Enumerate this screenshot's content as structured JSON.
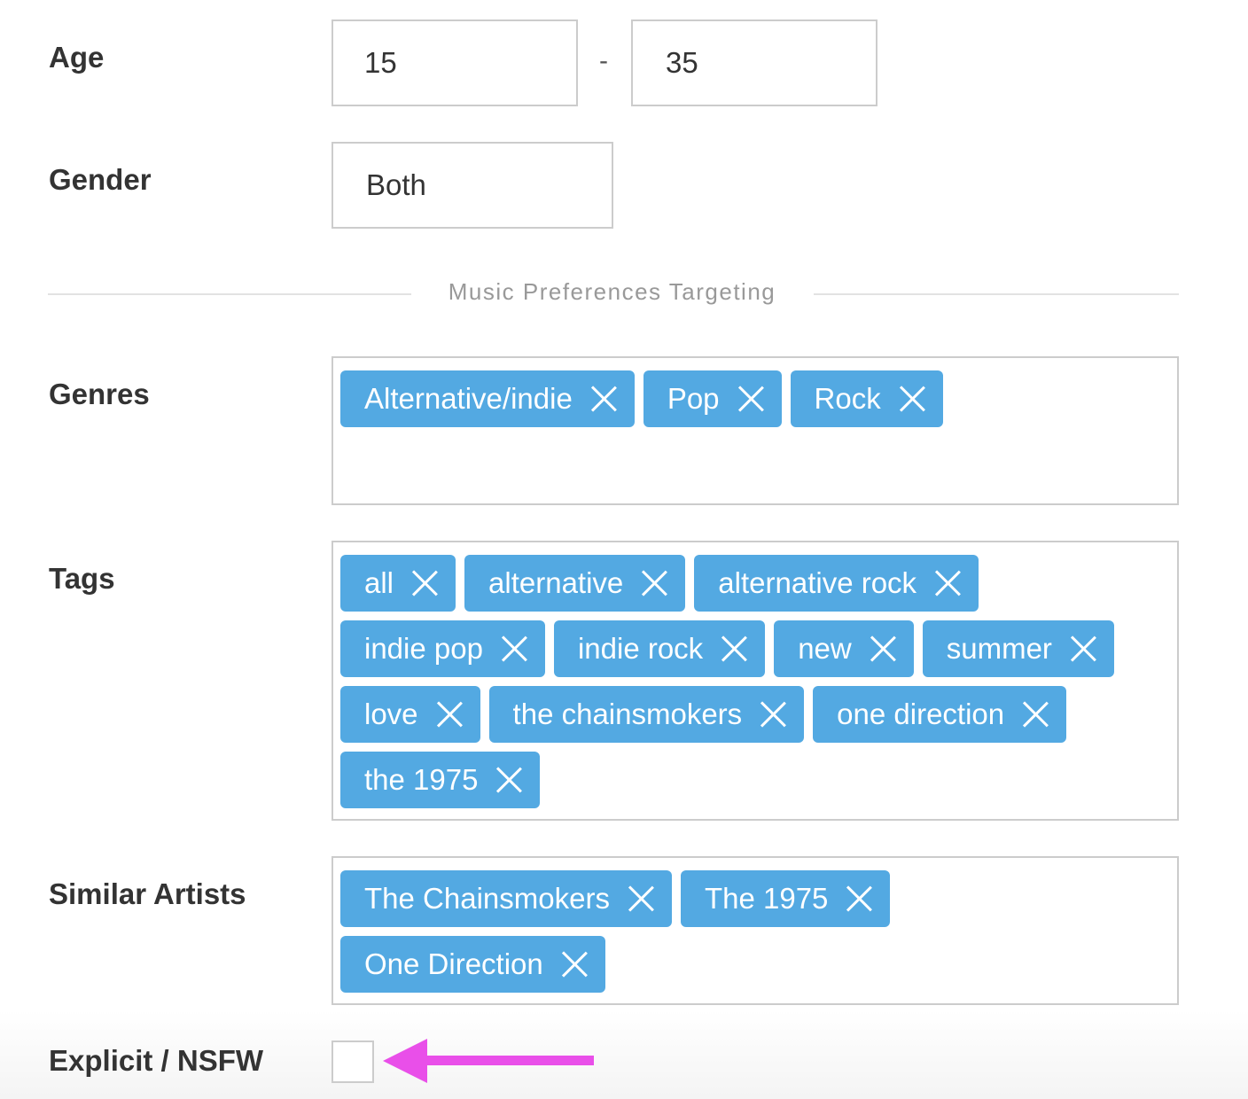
{
  "age": {
    "label": "Age",
    "min_value": "15",
    "separator": "-",
    "max_value": "35"
  },
  "gender": {
    "label": "Gender",
    "value": "Both"
  },
  "section_divider": "Music Preferences Targeting",
  "genres": {
    "label": "Genres",
    "tags": [
      "Alternative/indie",
      "Pop",
      "Rock"
    ]
  },
  "tags": {
    "label": "Tags",
    "tags": [
      "all",
      "alternative",
      "alternative rock",
      "indie pop",
      "indie rock",
      "new",
      "summer",
      "love",
      "the chainsmokers",
      "one direction",
      "the 1975"
    ]
  },
  "similar_artists": {
    "label": "Similar Artists",
    "tags": [
      "The Chainsmokers",
      "The 1975",
      "One Direction"
    ]
  },
  "explicit": {
    "label": "Explicit / NSFW",
    "checked": false
  },
  "colors": {
    "tag_bg": "#53a9e2",
    "annotation_arrow": "#e94fe9"
  }
}
